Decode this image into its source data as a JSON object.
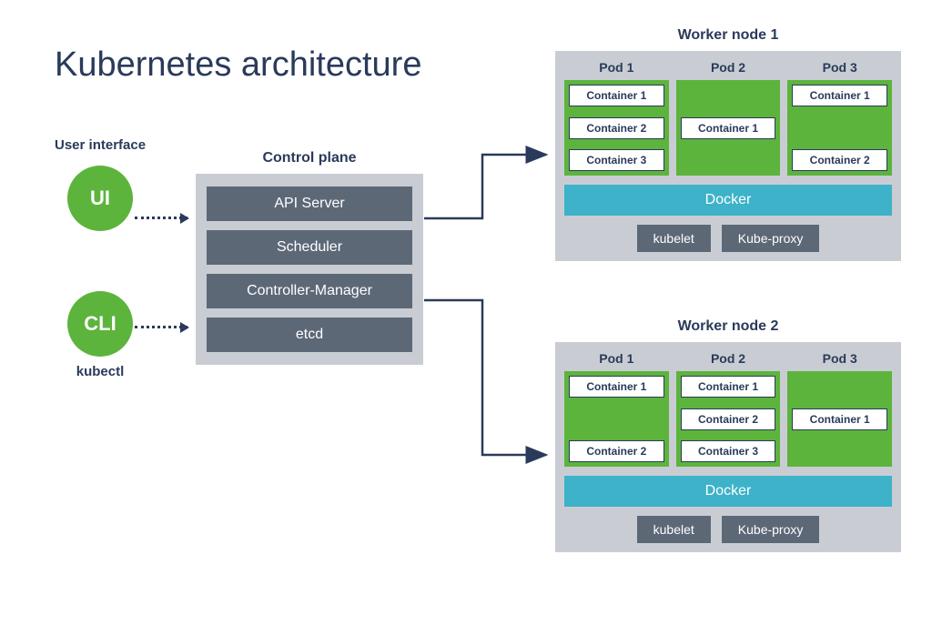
{
  "title": "Kubernetes architecture",
  "userInterface": {
    "heading": "User interface",
    "uiCircle": "UI",
    "cliCircle": "CLI",
    "cliSub": "kubectl"
  },
  "controlPlane": {
    "heading": "Control plane",
    "items": [
      "API Server",
      "Scheduler",
      "Controller-Manager",
      "etcd"
    ]
  },
  "workers": [
    {
      "heading": "Worker node 1",
      "pods": [
        {
          "label": "Pod 1",
          "containers": [
            "Container 1",
            "Container 2",
            "Container 3"
          ],
          "layout": "stack"
        },
        {
          "label": "Pod 2",
          "containers": [
            "Container 1"
          ],
          "layout": "center"
        },
        {
          "label": "Pod 3",
          "containers": [
            "Container 1",
            "Container 2"
          ],
          "layout": "spread"
        }
      ],
      "docker": "Docker",
      "agents": [
        "kubelet",
        "Kube-proxy"
      ]
    },
    {
      "heading": "Worker node 2",
      "pods": [
        {
          "label": "Pod 1",
          "containers": [
            "Container 1",
            "Container 2"
          ],
          "layout": "spread"
        },
        {
          "label": "Pod 2",
          "containers": [
            "Container 1",
            "Container 2",
            "Container 3"
          ],
          "layout": "stack"
        },
        {
          "label": "Pod 3",
          "containers": [
            "Container 1"
          ],
          "layout": "center"
        }
      ],
      "docker": "Docker",
      "agents": [
        "kubelet",
        "Kube-proxy"
      ]
    }
  ]
}
